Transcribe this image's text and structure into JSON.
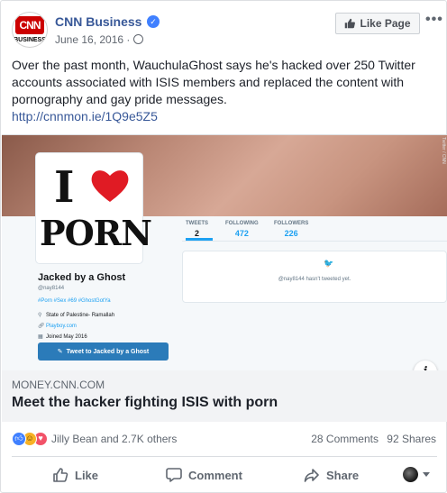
{
  "header": {
    "page_name": "CNN Business",
    "date": "June 16, 2016 ·",
    "avatar_text": "CNN",
    "avatar_subtext": "BUSINESS",
    "like_page_label": "Like Page",
    "more_icon": "ellipsis-icon"
  },
  "post": {
    "message": "Over the past month, WauchulaGhost says he's hacked over 250 Twitter accounts associated with ISIS members and replaced the content with pornography and gay pride messages.",
    "link": "http://cnnmon.ie/1Q9e5Z5"
  },
  "preview_image": {
    "card_top": "I",
    "card_bottom": "PORN",
    "stats": [
      {
        "label": "TWEETS",
        "value": "2"
      },
      {
        "label": "FOLLOWING",
        "value": "472"
      },
      {
        "label": "FOLLOWERS",
        "value": "226"
      }
    ],
    "no_tweets": "@nay8144 hasn't tweeted yet.",
    "profile_name": "Jacked by a Ghost",
    "profile_handle": "@nay8144",
    "profile_tags": "#Porn #Sex #69 #GhostGotYa",
    "location": "State of Palestine- Ramallah",
    "website": "Playboy.com",
    "joined": "Joined May 2016",
    "tweet_to_label": "Tweet to Jacked by a Ghost",
    "credit": "Twitter / CNN"
  },
  "preview_caption": {
    "domain": "MONEY.CNN.COM",
    "title": "Meet the hacker fighting ISIS with porn"
  },
  "engagement": {
    "reaction_icons": [
      "like-icon",
      "haha-icon",
      "love-icon"
    ],
    "reactors": "Jilly Bean and 2.7K others",
    "comments": "28 Comments",
    "shares": "92 Shares"
  },
  "actions": {
    "like": "Like",
    "comment": "Comment",
    "share": "Share"
  },
  "colors": {
    "link": "#385898",
    "twitter_blue": "#1da1f2",
    "reaction_like": "#4080ff",
    "reaction_love": "#f25268"
  }
}
